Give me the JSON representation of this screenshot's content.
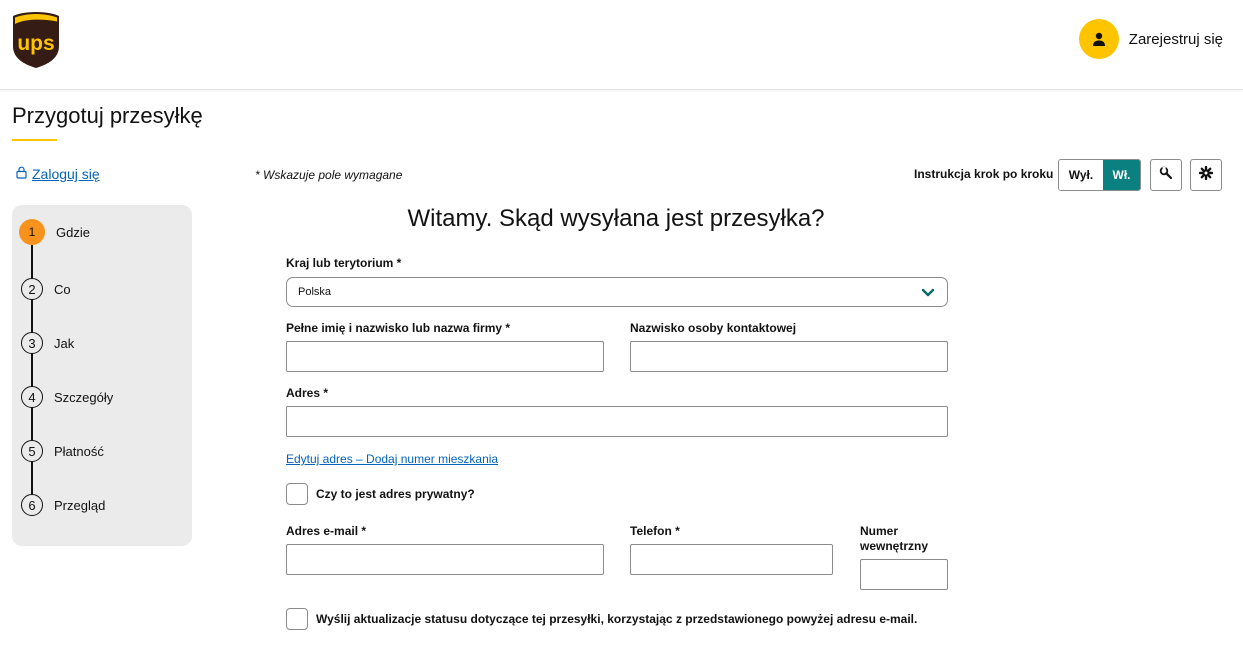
{
  "header": {
    "logo_text": "ups",
    "register_label": "Zarejestruj się"
  },
  "page": {
    "title": "Przygotuj przesyłkę",
    "login_label": "Zaloguj się",
    "required_note": "* Wskazuje pole wymagane"
  },
  "guide": {
    "label": "Instrukcja krok po kroku",
    "off_label": "Wył.",
    "on_label": "Wł.",
    "selected": "Wł."
  },
  "steps": [
    {
      "number": "1",
      "label": "Gdzie",
      "active": true
    },
    {
      "number": "2",
      "label": "Co"
    },
    {
      "number": "3",
      "label": "Jak"
    },
    {
      "number": "4",
      "label": "Szczegóły"
    },
    {
      "number": "5",
      "label": "Płatność"
    },
    {
      "number": "6",
      "label": "Przegląd"
    }
  ],
  "form": {
    "heading": "Witamy. Skąd wysyłana jest przesyłka?",
    "country_label": "Kraj lub terytorium *",
    "country_value": "Polska",
    "name_label": "Pełne imię i nazwisko lub nazwa firmy *",
    "name_value": "",
    "contact_label": "Nazwisko osoby kontaktowej",
    "contact_value": "",
    "address_label": "Adres *",
    "address_value": "",
    "edit_address_link": "Edytuj adres – Dodaj numer mieszkania",
    "private_address_label": "Czy to jest adres prywatny?",
    "private_address_checked": false,
    "email_label": "Adres e-mail *",
    "email_value": "",
    "phone_label": "Telefon *",
    "phone_value": "",
    "extension_label_line1": "Numer",
    "extension_label_line2": "wewnętrzny",
    "extension_value": "",
    "notify_label": "Wyślij aktualizacje statusu dotyczące tej przesyłki, korzystając z przedstawionego powyżej adresu e-mail.",
    "notify_checked": false
  },
  "colors": {
    "brand_brown": "#351c15",
    "brand_gold": "#ffc400",
    "teal": "#0a8080",
    "link_blue": "#0662bb",
    "step_active": "#f7931d"
  },
  "icons": [
    "ups-logo",
    "user-icon",
    "lock-icon",
    "wrench-icon",
    "gear-icon",
    "chevron-down-icon"
  ]
}
